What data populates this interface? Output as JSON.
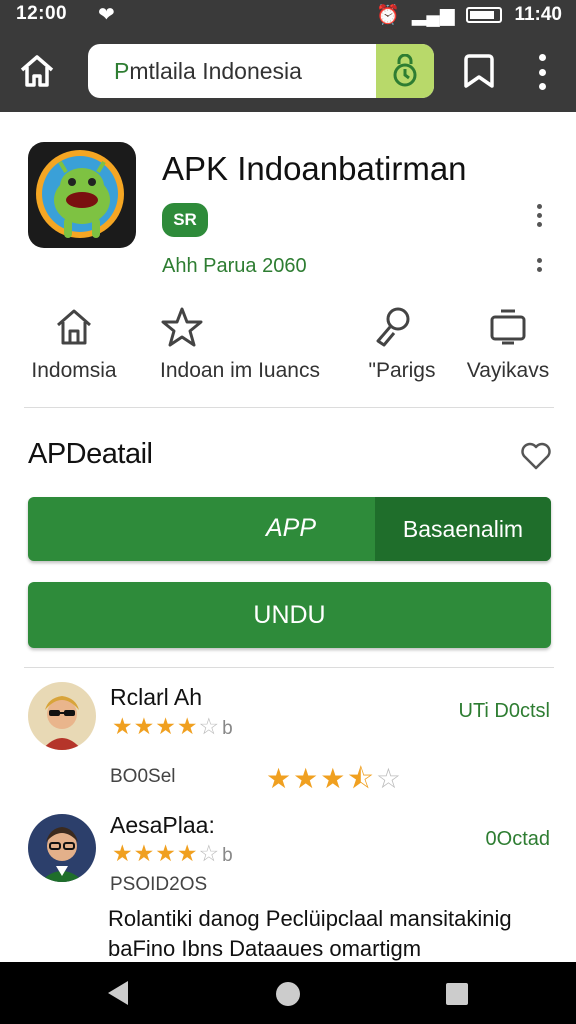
{
  "status_bar": {
    "time": "12:00",
    "clock_right": "11:40"
  },
  "browser": {
    "url_prefix": "P",
    "url_text": "mtlaila Indonesia",
    "home_icon": "home-icon",
    "bookmark_icon": "bookmark-icon",
    "menu_icon": "more-vert-icon"
  },
  "app": {
    "title": "APK Indoanbatirman",
    "badge": "SR",
    "subtitle": "Ahh Parua 2060"
  },
  "categories": [
    {
      "label": "Indomsia",
      "icon": "home-icon"
    },
    {
      "label": "Indoan im Iuancs",
      "icon": "star-icon"
    },
    {
      "label": "\"Parigs",
      "icon": "puzzle-icon"
    },
    {
      "label": "Vayikavs",
      "icon": "tv-icon"
    }
  ],
  "detail": {
    "title": "APDeatail",
    "app_button": "APP",
    "app_button_right": "Basaenalim",
    "download_button": "UNDU"
  },
  "reviews": [
    {
      "name": "Rclarl Ah",
      "rating_suffix": "b",
      "rating": 4,
      "date": "UTi D0ctsl",
      "meta": "BO0Sel",
      "meta_rating": 3.5
    },
    {
      "name": "AesaPlaa:",
      "rating_suffix": "b",
      "rating": 4,
      "date": "0Octad",
      "meta": "PSOID2OS",
      "body": "Rolantiki danog Peclüipclaal mansitakinig baFino Ibns Dataaues omartigm"
    }
  ],
  "colors": {
    "accent_green": "#2e8b3a",
    "dark_green": "#1f6e2b",
    "star": "#f0a020",
    "chrome": "#3a3a3a"
  }
}
